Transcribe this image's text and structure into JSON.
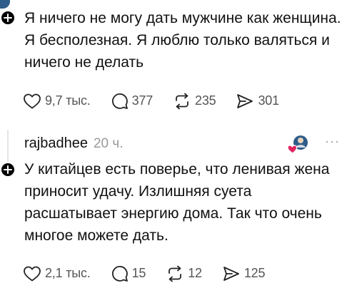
{
  "posts": [
    {
      "text": "Я ничего не могу дать мужчине как женщина. Я бесполезная. Я люблю только валяться и ничего не делать",
      "likes": "9,7 тыс.",
      "replies": "377",
      "reposts": "235",
      "shares": "301"
    },
    {
      "username": "rajbadhee",
      "time": "20 ч.",
      "more": "···",
      "text": "У китайцев есть поверье, что ленивая жена приносит удачу. Излишняя суета расшатывает энергию дома. Так что очень многое можете дать.",
      "likes": "2,1 тыс.",
      "replies": "15",
      "reposts": "12",
      "shares": "125"
    }
  ],
  "colors": {
    "text": "#111111",
    "muted": "#555555",
    "timestamp": "#999999",
    "badge": "#000000",
    "heart": "#e0245e"
  },
  "icons": [
    "plus-icon",
    "heart-icon",
    "comment-icon",
    "repost-icon",
    "share-icon",
    "more-icon"
  ]
}
